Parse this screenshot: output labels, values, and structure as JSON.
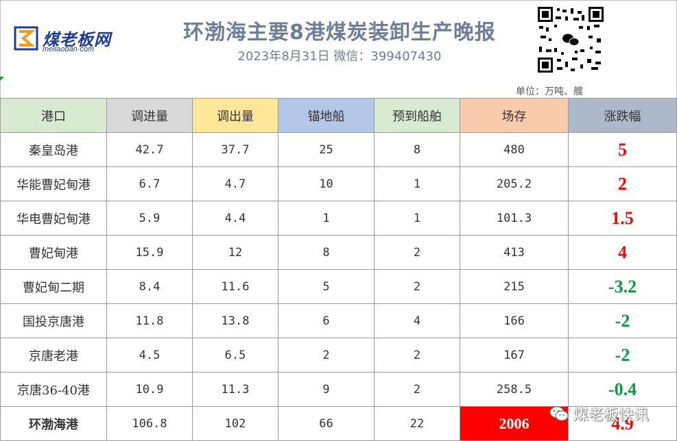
{
  "header": {
    "brand": "煤老板网",
    "site": "meilaoban·com",
    "title": "环渤海主要8港煤炭装卸生产晚报",
    "subtitle": "2023年8月31日  微信：399407430",
    "unit": "单位：万吨、艘"
  },
  "colors": {
    "header_port": "#d9ead3",
    "header_in": "#d9d9d9",
    "header_out": "#ffe699",
    "header_anchor": "#b4c7e7",
    "header_expected": "#d9ead3",
    "header_stock": "#f8cbad",
    "header_change": "#adb9ca",
    "up": "#ff0000",
    "down": "#0a9a45"
  },
  "table": {
    "columns": [
      "港口",
      "调进量",
      "调出量",
      "锚地船",
      "预到船舶",
      "场存",
      "涨跌幅"
    ],
    "rows": [
      {
        "port": "秦皇岛港",
        "in": "42.7",
        "out": "37.7",
        "anchor": "25",
        "expected": "8",
        "stock": "480",
        "change": "5",
        "dir": "up"
      },
      {
        "port": "华能曹妃甸港",
        "in": "6.7",
        "out": "4.7",
        "anchor": "10",
        "expected": "1",
        "stock": "205.2",
        "change": "2",
        "dir": "up"
      },
      {
        "port": "华电曹妃甸港",
        "in": "5.9",
        "out": "4.4",
        "anchor": "1",
        "expected": "1",
        "stock": "101.3",
        "change": "1.5",
        "dir": "up"
      },
      {
        "port": "曹妃甸港",
        "in": "15.9",
        "out": "12",
        "anchor": "8",
        "expected": "2",
        "stock": "413",
        "change": "4",
        "dir": "up"
      },
      {
        "port": "曹妃甸二期",
        "in": "8.4",
        "out": "11.6",
        "anchor": "5",
        "expected": "2",
        "stock": "215",
        "change": "-3.2",
        "dir": "down"
      },
      {
        "port": "国投京唐港",
        "in": "11.8",
        "out": "13.8",
        "anchor": "6",
        "expected": "4",
        "stock": "166",
        "change": "-2",
        "dir": "down"
      },
      {
        "port": "京唐老港",
        "in": "4.5",
        "out": "6.5",
        "anchor": "2",
        "expected": "2",
        "stock": "167",
        "change": "-2",
        "dir": "down"
      },
      {
        "port": "京唐36-40港",
        "in": "10.9",
        "out": "11.3",
        "anchor": "9",
        "expected": "2",
        "stock": "258.5",
        "change": "-0.4",
        "dir": "down"
      }
    ],
    "total": {
      "port": "环渤海港",
      "in": "106.8",
      "out": "102",
      "anchor": "66",
      "expected": "22",
      "stock": "2006",
      "change": "4.9",
      "dir": "up"
    }
  },
  "watermark": {
    "text": "煤老板快讯",
    "icon": "wechat-icon"
  }
}
